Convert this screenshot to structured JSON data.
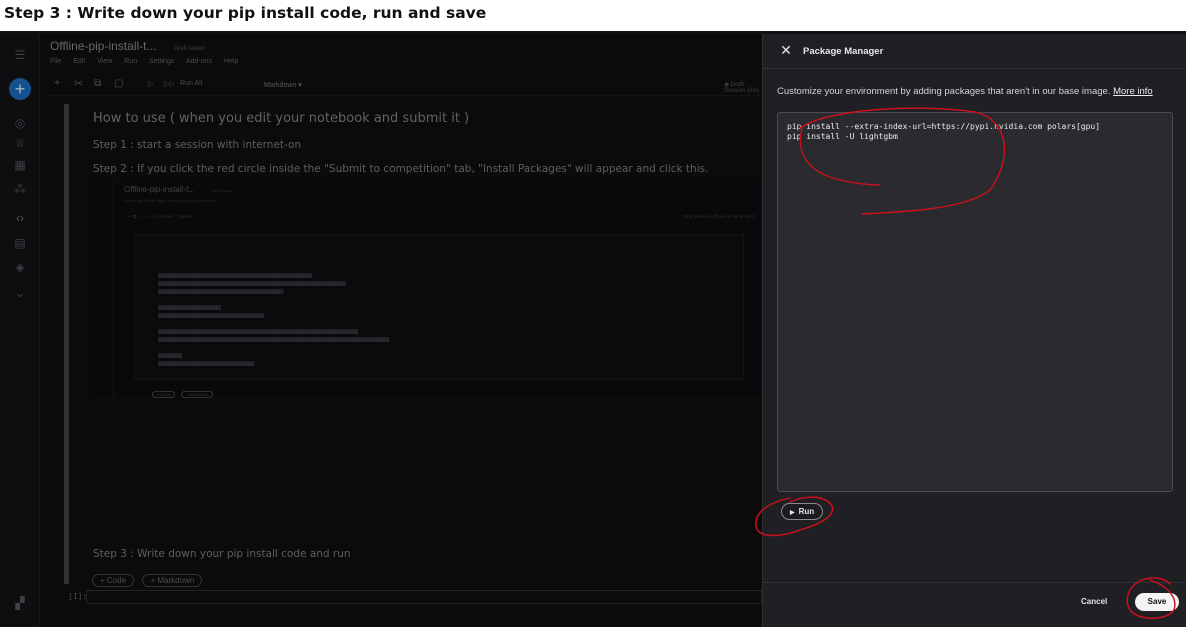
{
  "heading": "Step 3 : Write down your pip install code, run and save",
  "notebook": {
    "title": "Offline-pip-install-t...",
    "draft_label": "Draft saved",
    "menu": [
      "File",
      "Edit",
      "View",
      "Run",
      "Settings",
      "Add-ons",
      "Help"
    ],
    "run_all": "Run All",
    "cell_type": "Markdown",
    "session": "Draft Session (0m)",
    "how_to_use": "How to use ( when you edit your notebook and submit it )",
    "step1": "Step 1 : start a session with internet-on",
    "step2": "Step 2 : If you click the red circle inside the \"Submit to competition\" tab, \"Install Packages\" will appear and click this.",
    "step3": "Step 3 : Write down your pip install code and run",
    "add_code": "+ Code",
    "add_markdown": "+ Markdown",
    "cell_index": "[1]:",
    "embedded": {
      "title": "Offline-pip-install-t...",
      "draft_label": "Draft saved",
      "menu": "File  Edit  View  Run  Settings  Add-ons  Help",
      "run_all": "Run All",
      "cell_type": "Code",
      "session": "Draft Session off (run a cell to start)",
      "add_code": "+ Code",
      "add_markdown": "+ Markdown"
    }
  },
  "panel": {
    "title": "Package Manager",
    "description": "Customize your environment by adding packages that aren't in our base image.",
    "more_info": "More info",
    "code_lines": [
      "pip install --extra-index-url=https://pypi.nvidia.com polars[gpu]",
      "pip install -U lightgbm"
    ],
    "run_label": "Run",
    "cancel_label": "Cancel",
    "save_label": "Save"
  },
  "colors": {
    "annotation": "#d0101a",
    "panel_bg": "#202024",
    "page_bg": "#0d0d0f"
  }
}
